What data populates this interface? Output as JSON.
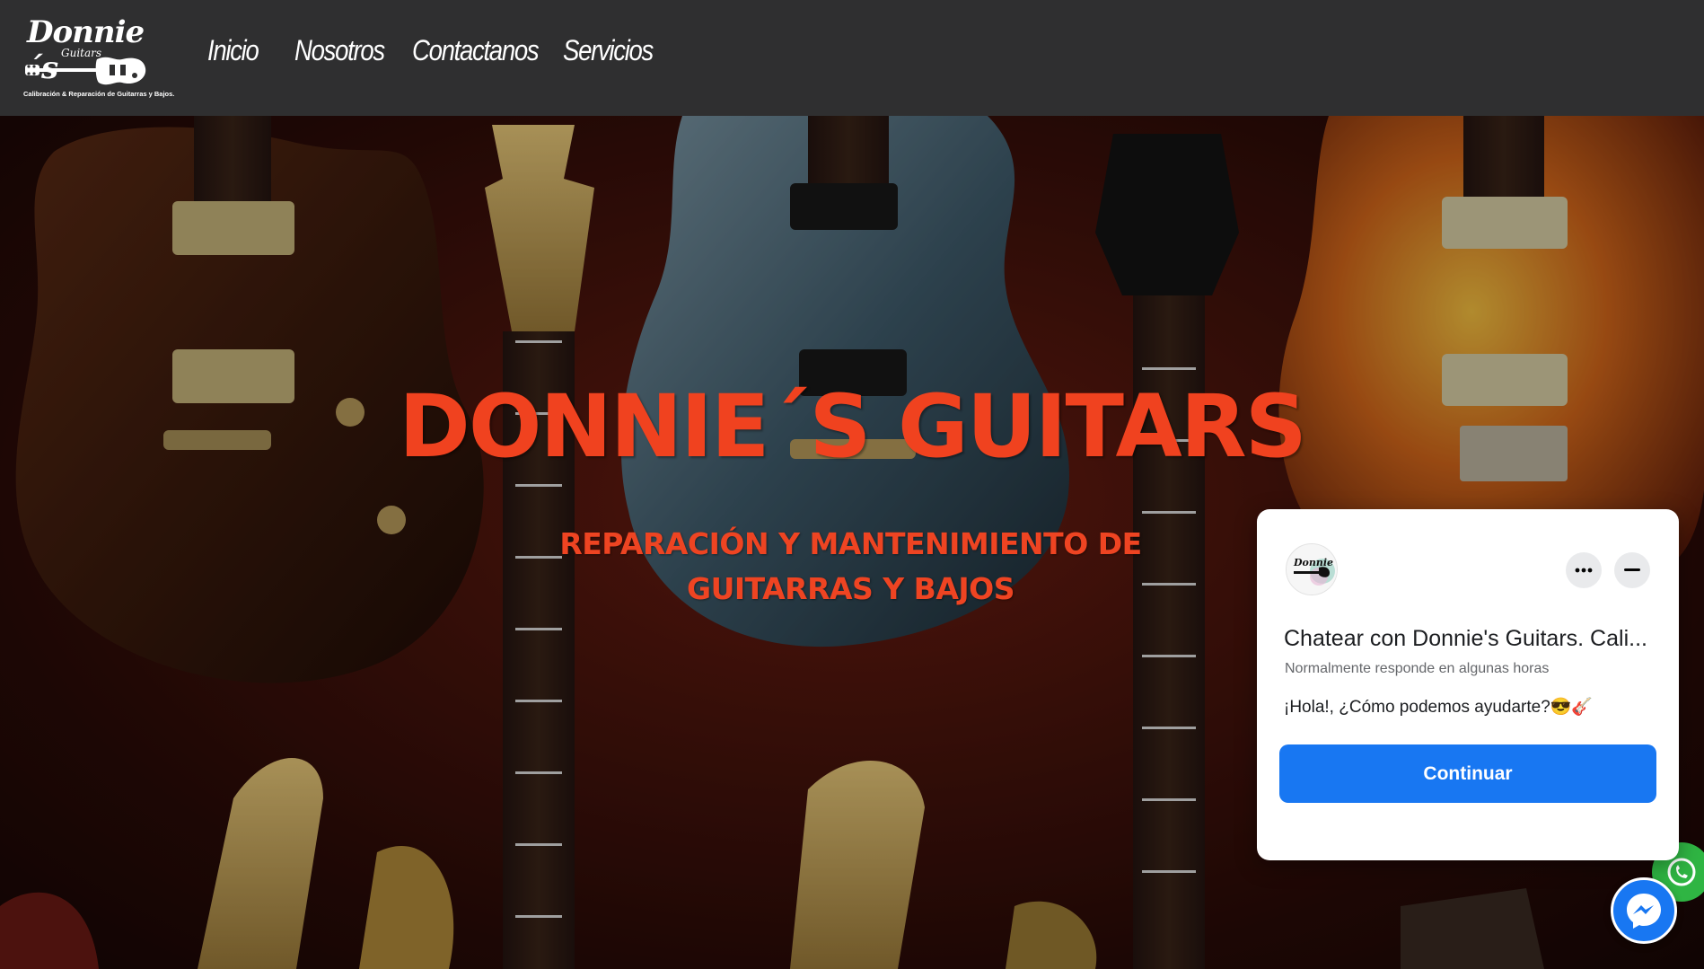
{
  "header": {
    "logo": {
      "script_text": "Donnie´s",
      "sub_text": "Guitars",
      "tagline": "Calibración & Reparación de Guitarras y Bajos."
    },
    "nav": [
      {
        "label": "Inicio"
      },
      {
        "label": "Nosotros"
      },
      {
        "label": "Contactanos"
      },
      {
        "label": "Servicios"
      }
    ]
  },
  "hero": {
    "title": "DONNIE´S GUITARS",
    "subtitle": "REPARACIÓN Y MANTENIMIENTO DE GUITARRAS Y BAJOS",
    "title_color": "#f0421f"
  },
  "chat_widget": {
    "title": "Chatear con Donnie's Guitars. Cali...",
    "subtitle": "Normalmente responde en algunas horas",
    "message": "¡Hola!, ¿Cómo podemos ayudarte?😎🎸",
    "continue_label": "Continuar",
    "accent_color": "#1877f2",
    "more_icon": "more-horizontal-icon",
    "minimize_icon": "minimize-icon"
  },
  "floating": {
    "whatsapp_icon": "whatsapp-icon",
    "messenger_icon": "messenger-icon"
  }
}
